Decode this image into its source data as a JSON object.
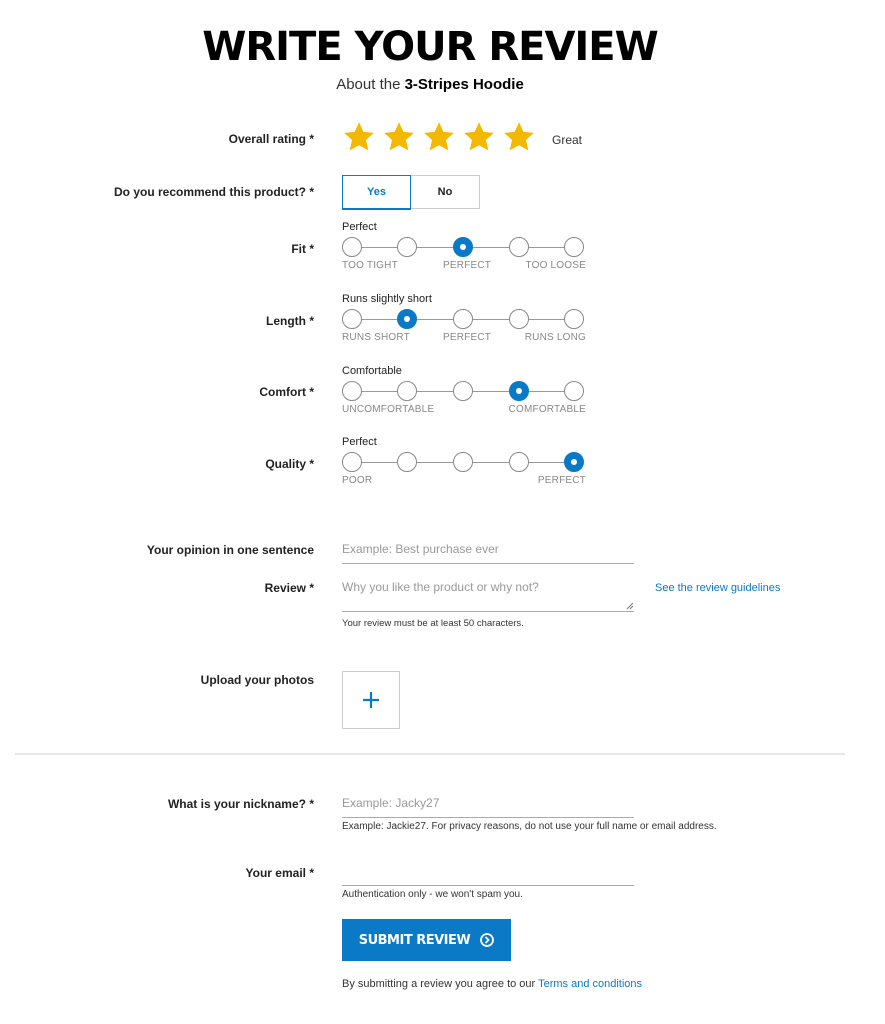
{
  "header": {
    "title": "WRITE YOUR REVIEW",
    "subtitle_prefix": "About the ",
    "product_name": "3-Stripes Hoodie"
  },
  "overall_rating": {
    "label": "Overall rating *",
    "value": 5,
    "max": 5,
    "word": "Great",
    "star_color": "#f5b800"
  },
  "recommend": {
    "label": "Do you recommend this product? *",
    "yes": "Yes",
    "no": "No",
    "selected": "Yes"
  },
  "fit": {
    "label": "Fit *",
    "value_text": "Perfect",
    "selected_index": 2,
    "captions": [
      "TOO TIGHT",
      "PERFECT",
      "TOO LOOSE"
    ]
  },
  "length": {
    "label": "Length *",
    "value_text": "Runs slightly short",
    "selected_index": 1,
    "captions": [
      "RUNS SHORT",
      "PERFECT",
      "RUNS LONG"
    ]
  },
  "comfort": {
    "label": "Comfort *",
    "value_text": "Comfortable",
    "selected_index": 3,
    "captions": [
      "UNCOMFORTABLE",
      "COMFORTABLE"
    ]
  },
  "quality": {
    "label": "Quality *",
    "value_text": "Perfect",
    "selected_index": 4,
    "captions": [
      "POOR",
      "PERFECT"
    ]
  },
  "opinion": {
    "label": "Your opinion in one sentence",
    "placeholder": "Example: Best purchase ever"
  },
  "review": {
    "label": "Review *",
    "placeholder": "Why you like the product or why not?",
    "guidelines_link": "See the review guidelines",
    "help": "Your review must be at least 50 characters."
  },
  "photos": {
    "label": "Upload your photos",
    "add_icon": "plus-icon"
  },
  "nickname": {
    "label": "What is your nickname? *",
    "placeholder": "Example: Jacky27",
    "help": "Example: Jackie27. For privacy reasons, do not use your full name or email address."
  },
  "email": {
    "label": "Your email *",
    "placeholder": "",
    "help": "Authentication only - we won't spam you."
  },
  "submit": {
    "label": "SUBMIT REVIEW",
    "icon": "arrow-right-circle-icon",
    "color": "#0a7ac7"
  },
  "terms": {
    "prefix": "By submitting a review you agree to our ",
    "link": "Terms and conditions"
  }
}
